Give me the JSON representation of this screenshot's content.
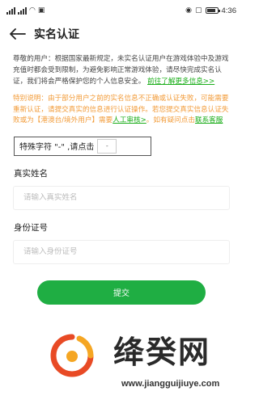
{
  "status_bar": {
    "network_label": "",
    "time": "4:36"
  },
  "header": {
    "title": "实名认证"
  },
  "notice": {
    "text": "尊敬的用户：根据国家最新规定，未实名认证用户在游戏体验中及游戏充值时都会受到限制，为避免影响正常游戏体验，请尽快完成实名认证，我们将会严格保护您的个人信息安全。",
    "link": "前往了解更多信息>>"
  },
  "warning": {
    "text": "特别说明：由于部分用户之前的实名信息不正确或认证失败，可能需要重新认证，请提交真实的信息进行认证操作。若您提交真实信息认证失败或为【港澳台/境外用户】需要",
    "review_link": "人工审核>",
    "mid_text": "。如有疑问点击",
    "contact_link": "联系客服"
  },
  "captcha": {
    "label": "特殊字符 \"-\" ,请点击",
    "box_char": "-"
  },
  "form": {
    "name_label": "真实姓名",
    "name_placeholder": "请输入真实姓名",
    "id_label": "身份证号",
    "id_placeholder": "请输入身份证号",
    "submit_label": "提交"
  },
  "watermark": {
    "brand": "绛癸网",
    "url": "www.jiangguijiuye.com"
  },
  "colors": {
    "accent": "#1fae43",
    "warning": "#f29b38",
    "link": "#1aad19"
  }
}
